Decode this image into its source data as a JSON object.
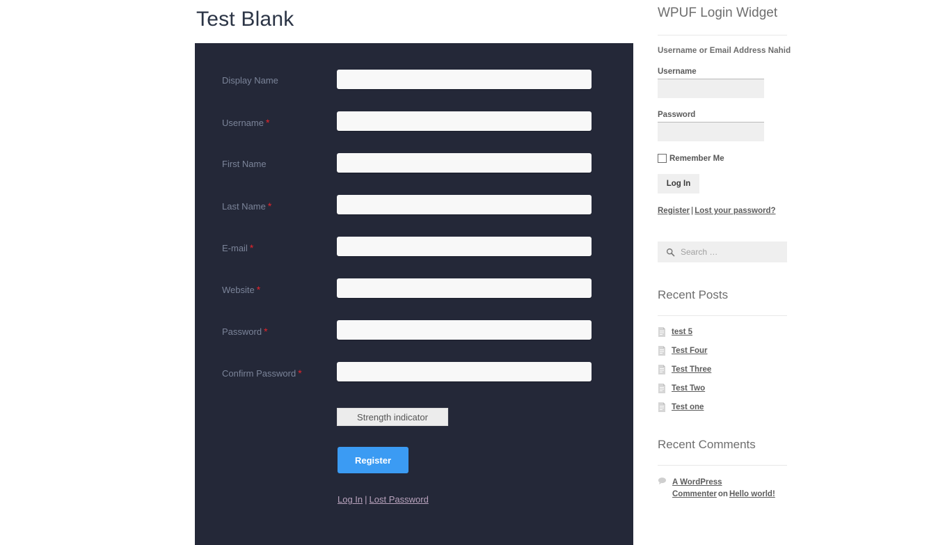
{
  "page": {
    "title": "Test Blank",
    "background": "#ffffff",
    "panel_color": "#242838",
    "accent_color": "#3b9bf3",
    "required_color": "#e8242a",
    "label_color": "#7b8499"
  },
  "form": {
    "fields": [
      {
        "label": "Display Name",
        "required": false,
        "value": "",
        "placeholder": ""
      },
      {
        "label": "Username",
        "required": true,
        "value": "",
        "placeholder": ""
      },
      {
        "label": "First Name",
        "required": false,
        "value": "",
        "placeholder": ""
      },
      {
        "label": "Last Name",
        "required": true,
        "value": "",
        "placeholder": ""
      },
      {
        "label": "E-mail",
        "required": true,
        "value": "",
        "placeholder": ""
      },
      {
        "label": "Website",
        "required": true,
        "value": "",
        "placeholder": ""
      },
      {
        "label": "Password",
        "required": true,
        "value": "",
        "placeholder": ""
      },
      {
        "label": "Confirm Password",
        "required": true,
        "value": "",
        "placeholder": ""
      }
    ],
    "required_marker": "*",
    "strength_indicator": "Strength indicator",
    "submit_label": "Register",
    "login_link": "Log In",
    "separator": "|",
    "lost_password_link": "Lost Password"
  },
  "sidebar": {
    "login_widget": {
      "title": "WPUF Login Widget",
      "note": "Username or Email Address Nahid",
      "username_label": "Username",
      "username_value": "",
      "password_label": "Password",
      "password_value": "",
      "remember_label": "Remember Me",
      "submit_label": "Log In",
      "register_link": "Register",
      "separator": "|",
      "lost_password_link": "Lost your password?"
    },
    "search": {
      "placeholder": "Search …",
      "value": "",
      "icon": "search-icon"
    },
    "recent_posts": {
      "title": "Recent Posts",
      "items": [
        {
          "label": "test 5",
          "icon": "document-icon"
        },
        {
          "label": "Test Four",
          "icon": "document-icon"
        },
        {
          "label": "Test Three",
          "icon": "document-icon"
        },
        {
          "label": "Test Two",
          "icon": "document-icon"
        },
        {
          "label": "Test one",
          "icon": "document-icon"
        }
      ]
    },
    "recent_comments": {
      "title": "Recent Comments",
      "items": [
        {
          "author": "A WordPress Commenter",
          "connector": "on",
          "post": "Hello world!",
          "icon": "comment-icon"
        }
      ]
    }
  }
}
